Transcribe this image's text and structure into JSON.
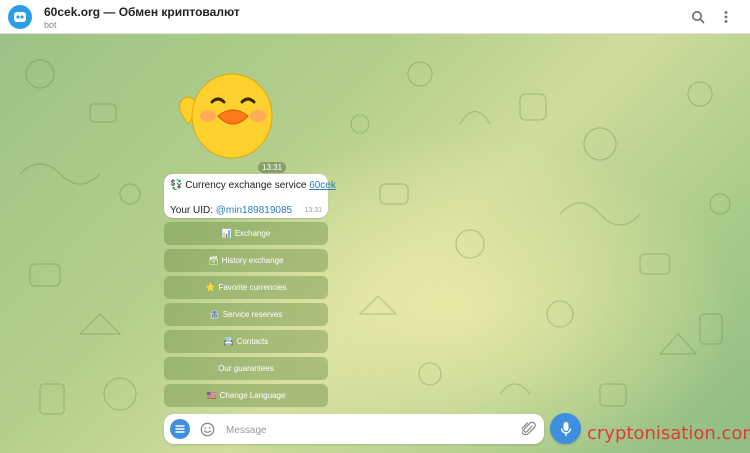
{
  "header": {
    "title": "60cek.org — Обмен криптовалют",
    "subtitle": "bot"
  },
  "sticker": {
    "icon": "duck-sticker",
    "time": "13:31"
  },
  "message": {
    "icon": "exchange-emoji",
    "text": "Currency exchange service",
    "link": "60cek",
    "uid_label": "Your UID:",
    "uid_value": "@min189819085",
    "time": "13:31"
  },
  "keyboard": [
    {
      "emoji": "📊",
      "label": "Exchange"
    },
    {
      "emoji": "🗃",
      "label": "History exchange"
    },
    {
      "emoji": "⭐",
      "label": "Favorite currencies"
    },
    {
      "emoji": "🏦",
      "label": "Service reserves"
    },
    {
      "emoji": "📇",
      "label": "Contacts"
    },
    {
      "emoji": "",
      "label": "Our guarantees"
    },
    {
      "emoji": "🇺🇸",
      "label": "Change Language"
    }
  ],
  "composer": {
    "placeholder": "Message"
  },
  "watermark": "cryptonisation.com",
  "colors": {
    "accent": "#3f8fe0",
    "link": "#2a7bc2",
    "watermark": "#e03a3a"
  }
}
